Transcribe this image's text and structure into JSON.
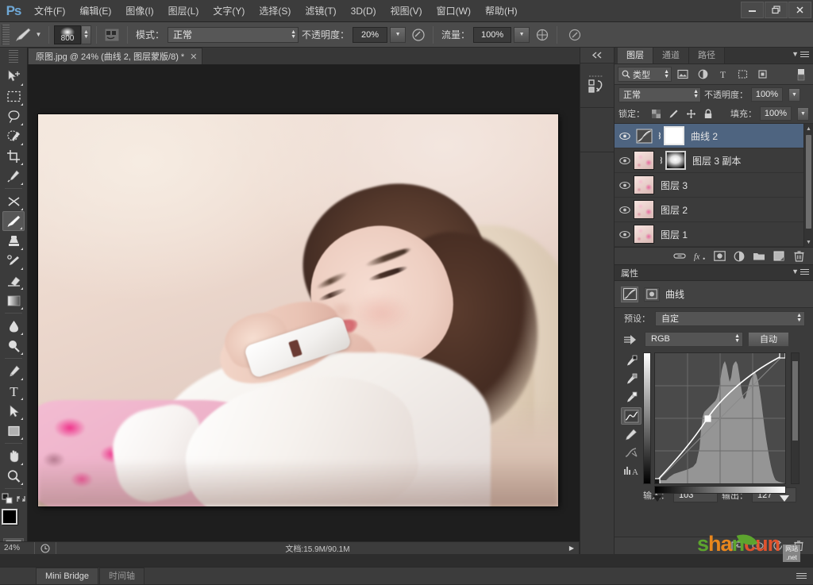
{
  "app": {
    "logo": "Ps",
    "menus": [
      {
        "label": "文件(F)"
      },
      {
        "label": "编辑(E)"
      },
      {
        "label": "图像(I)"
      },
      {
        "label": "图层(L)"
      },
      {
        "label": "文字(Y)"
      },
      {
        "label": "选择(S)"
      },
      {
        "label": "滤镜(T)"
      },
      {
        "label": "3D(D)"
      },
      {
        "label": "视图(V)"
      },
      {
        "label": "窗口(W)"
      },
      {
        "label": "帮助(H)"
      }
    ],
    "window_controls": {
      "minimize": "—",
      "restore": "❐",
      "close": "✕"
    }
  },
  "options_bar": {
    "brush_size": "800",
    "mode_label": "模式：",
    "mode_value": "正常",
    "opacity_label": "不透明度：",
    "opacity_value": "20%",
    "flow_label": "流量：",
    "flow_value": "100%"
  },
  "document_tab": {
    "title": "原图.jpg @ 24% (曲线 2, 图层蒙版/8) *",
    "close": "✕"
  },
  "toolbar": {
    "tools": [
      {
        "name": "move-tool",
        "label": "移动工具"
      },
      {
        "name": "marquee-tool",
        "label": "矩形选框工具"
      },
      {
        "name": "lasso-tool",
        "label": "套索工具"
      },
      {
        "name": "quick-selection-tool",
        "label": "快速选择工具"
      },
      {
        "name": "crop-tool",
        "label": "裁剪工具"
      },
      {
        "name": "eyedropper-tool",
        "label": "吸管工具"
      },
      {
        "name": "healing-brush-tool",
        "label": "污点修复画笔工具"
      },
      {
        "name": "brush-tool",
        "label": "画笔工具",
        "active": true
      },
      {
        "name": "clone-stamp-tool",
        "label": "仿制图章工具"
      },
      {
        "name": "history-brush-tool",
        "label": "历史记录画笔工具"
      },
      {
        "name": "eraser-tool",
        "label": "橡皮擦工具"
      },
      {
        "name": "gradient-tool",
        "label": "渐变工具"
      },
      {
        "name": "blur-tool",
        "label": "模糊工具"
      },
      {
        "name": "dodge-tool",
        "label": "减淡工具"
      },
      {
        "name": "pen-tool",
        "label": "钢笔工具"
      },
      {
        "name": "type-tool",
        "label": "横排文字工具"
      },
      {
        "name": "path-selection-tool",
        "label": "路径选择工具"
      },
      {
        "name": "shape-tool",
        "label": "矩形工具"
      },
      {
        "name": "hand-tool",
        "label": "抓手工具"
      },
      {
        "name": "zoom-tool",
        "label": "缩放工具"
      }
    ],
    "foreground_color": "#000000",
    "background_color": "#ffffff"
  },
  "layers_panel": {
    "tabs": [
      {
        "label": "图层",
        "selected": true
      },
      {
        "label": "通道",
        "selected": false
      },
      {
        "label": "路径",
        "selected": false
      }
    ],
    "filter_value": "类型",
    "blend_mode": "正常",
    "opacity_label": "不透明度：",
    "opacity_value": "100%",
    "lock_label": "锁定：",
    "fill_label": "填充：",
    "fill_value": "100%",
    "layers": [
      {
        "name": "曲线 2",
        "type": "adjustment",
        "selected": true,
        "visible": true,
        "has_mask": true,
        "mask": "white",
        "linked": true
      },
      {
        "name": "图层 3 副本",
        "type": "pixel",
        "selected": false,
        "visible": true,
        "has_mask": true,
        "mask": "gradient",
        "linked": true
      },
      {
        "name": "图层 3",
        "type": "pixel",
        "selected": false,
        "visible": true,
        "has_mask": false,
        "linked": false
      },
      {
        "name": "图层 2",
        "type": "pixel",
        "selected": false,
        "visible": true,
        "has_mask": false,
        "linked": false
      },
      {
        "name": "图层 1",
        "type": "pixel",
        "selected": false,
        "visible": true,
        "has_mask": false,
        "linked": false
      }
    ]
  },
  "properties_panel": {
    "header": "属性",
    "title": "曲线",
    "preset_label": "预设：",
    "preset_value": "自定",
    "channel_value": "RGB",
    "auto_button": "自动",
    "input_label": "输入：",
    "input_value": "103",
    "output_label": "输出：",
    "output_value": "127"
  },
  "curves": {
    "point_input": 103,
    "point_output": 127,
    "black_point": 0,
    "white_point": 255
  },
  "status_bar": {
    "zoom": "24%",
    "doc_info": "文档:15.9M/90.1M"
  },
  "bottom_tabs": [
    {
      "label": "Mini Bridge",
      "active": true
    },
    {
      "label": "时间轴",
      "active": false
    }
  ],
  "watermark": {
    "part1": "s",
    "part2": "h",
    "part3": "a",
    "part4": "n",
    "part5": "c",
    "part6": "u",
    "part7": "n",
    "badge_top": "网站",
    "badge_bottom": ".net"
  },
  "colors": {
    "selection_blue": "#4e6480",
    "panel_bg": "#3b3b3b",
    "menu_bg": "#3c3c3c",
    "canvas_bg": "#1e1e1e"
  }
}
